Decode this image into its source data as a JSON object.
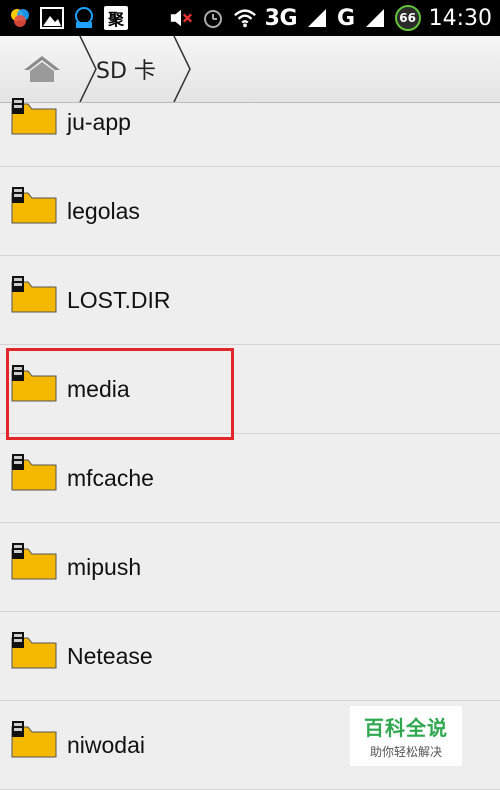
{
  "status_bar": {
    "badge": "聚",
    "network1": "3G",
    "network2": "G",
    "battery": "66",
    "time": "14:30"
  },
  "toolbar": {
    "crumb": "SD 卡"
  },
  "files": [
    {
      "name": "ju-app"
    },
    {
      "name": "legolas"
    },
    {
      "name": "LOST.DIR"
    },
    {
      "name": "media"
    },
    {
      "name": "mfcache"
    },
    {
      "name": "mipush"
    },
    {
      "name": "Netease"
    },
    {
      "name": "niwodai"
    }
  ],
  "watermark": {
    "title": "百科全说",
    "subtitle": "助你轻松解决"
  },
  "colors": {
    "highlight": "#e3262a",
    "folder": "#f5b800",
    "watermark_green": "#2fa84f"
  }
}
